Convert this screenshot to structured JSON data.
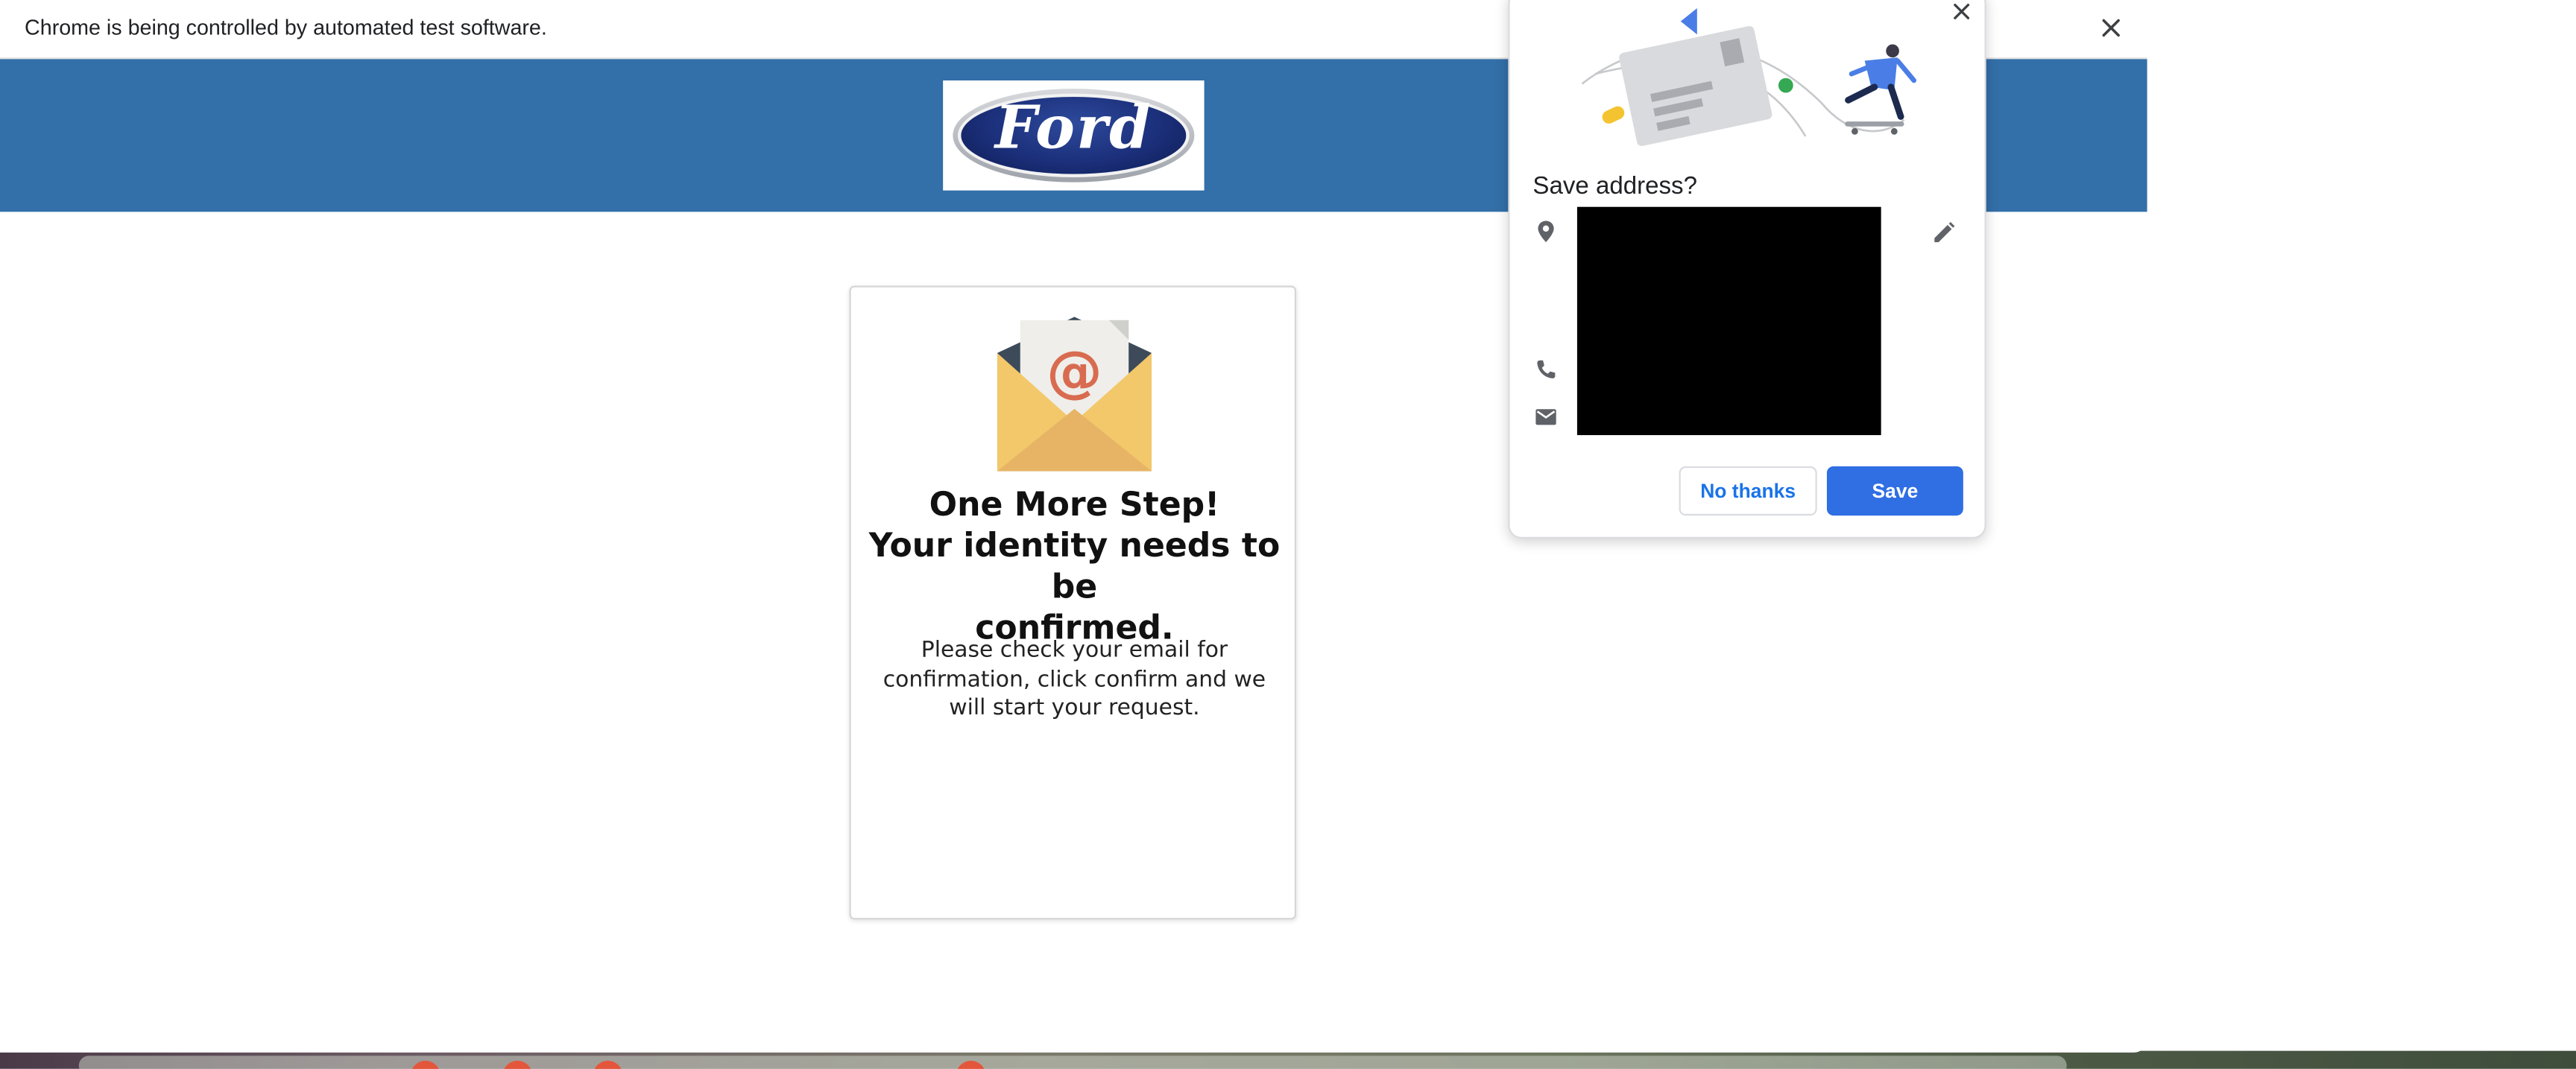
{
  "automation_bar": {
    "message": "Chrome is being controlled by automated test software.",
    "close_icon": "close-icon"
  },
  "header": {
    "brand_color": "#336fa8",
    "logo_text": "Ford"
  },
  "card": {
    "illustration_icon": "envelope-at-icon",
    "title_line1": "One More Step!",
    "title_line2": "Your identity needs to be",
    "title_line3": "confirmed.",
    "body": "Please check your email for confirmation, click confirm and we will start your request."
  },
  "save_address_popup": {
    "title": "Save address?",
    "icons": [
      "location-pin-icon",
      "phone-icon",
      "email-icon",
      "edit-pencil-icon",
      "close-icon"
    ],
    "no_thanks_label": "No thanks",
    "save_label": "Save",
    "accent_color": "#2f6ee3"
  }
}
